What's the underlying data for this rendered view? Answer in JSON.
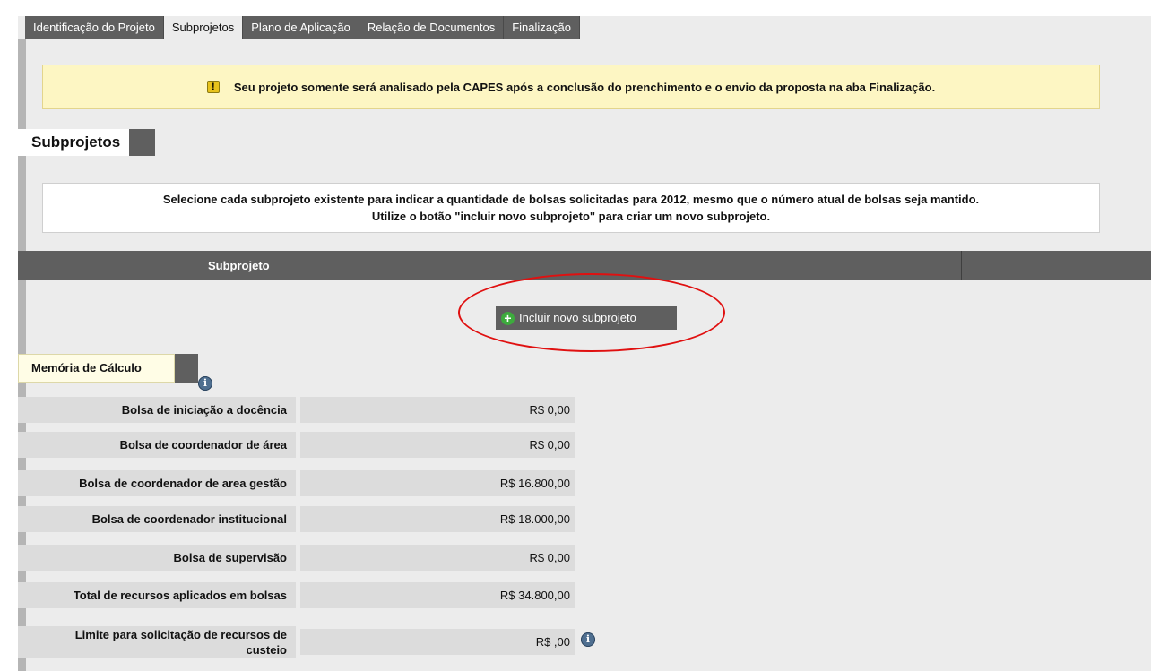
{
  "tabs": [
    {
      "label": "Identificação do Projeto",
      "active": false
    },
    {
      "label": "Subprojetos",
      "active": true
    },
    {
      "label": "Plano de Aplicação",
      "active": false
    },
    {
      "label": "Relação de Documentos",
      "active": false
    },
    {
      "label": "Finalização",
      "active": false
    }
  ],
  "alert": {
    "icon": "warning-icon",
    "text": "Seu projeto somente será analisado pela CAPES após a conclusão do prenchimento e o envio da proposta na aba Finalização."
  },
  "section": {
    "title": "Subprojetos"
  },
  "instructions": {
    "line1": "Selecione cada subprojeto existente para indicar a quantidade de bolsas solicitadas para 2012, mesmo que o número atual de bolsas seja mantido.",
    "line2": "Utilize o botão \"incluir novo subprojeto\" para criar um novo subprojeto."
  },
  "table": {
    "headers": [
      "Subprojeto"
    ]
  },
  "add_button": {
    "label": "Incluir novo subprojeto",
    "icon": "plus-icon"
  },
  "memoria": {
    "title": "Memória de Cálculo",
    "rows": [
      {
        "label": "Bolsa de iniciação a docência",
        "value": "R$ 0,00"
      },
      {
        "label": "Bolsa de coordenador de área",
        "value": "R$ 0,00"
      },
      {
        "label": "Bolsa de coordenador de area gestão",
        "value": "R$ 16.800,00"
      },
      {
        "label": "Bolsa de coordenador institucional",
        "value": "R$ 18.000,00"
      },
      {
        "label": "Bolsa de supervisão",
        "value": "R$ 0,00"
      },
      {
        "label": "Total de recursos aplicados em bolsas",
        "value": "R$ 34.800,00"
      }
    ],
    "limit_row": {
      "label_line1": "Limite para solicitação de recursos de",
      "label_line2": "custeio",
      "value": "R$ ,00"
    }
  },
  "colors": {
    "tab_bg": "#5f5f5f",
    "page_bg": "#ececec",
    "alert_bg": "#fdf6c3",
    "highlight_ellipse": "#e01010"
  }
}
